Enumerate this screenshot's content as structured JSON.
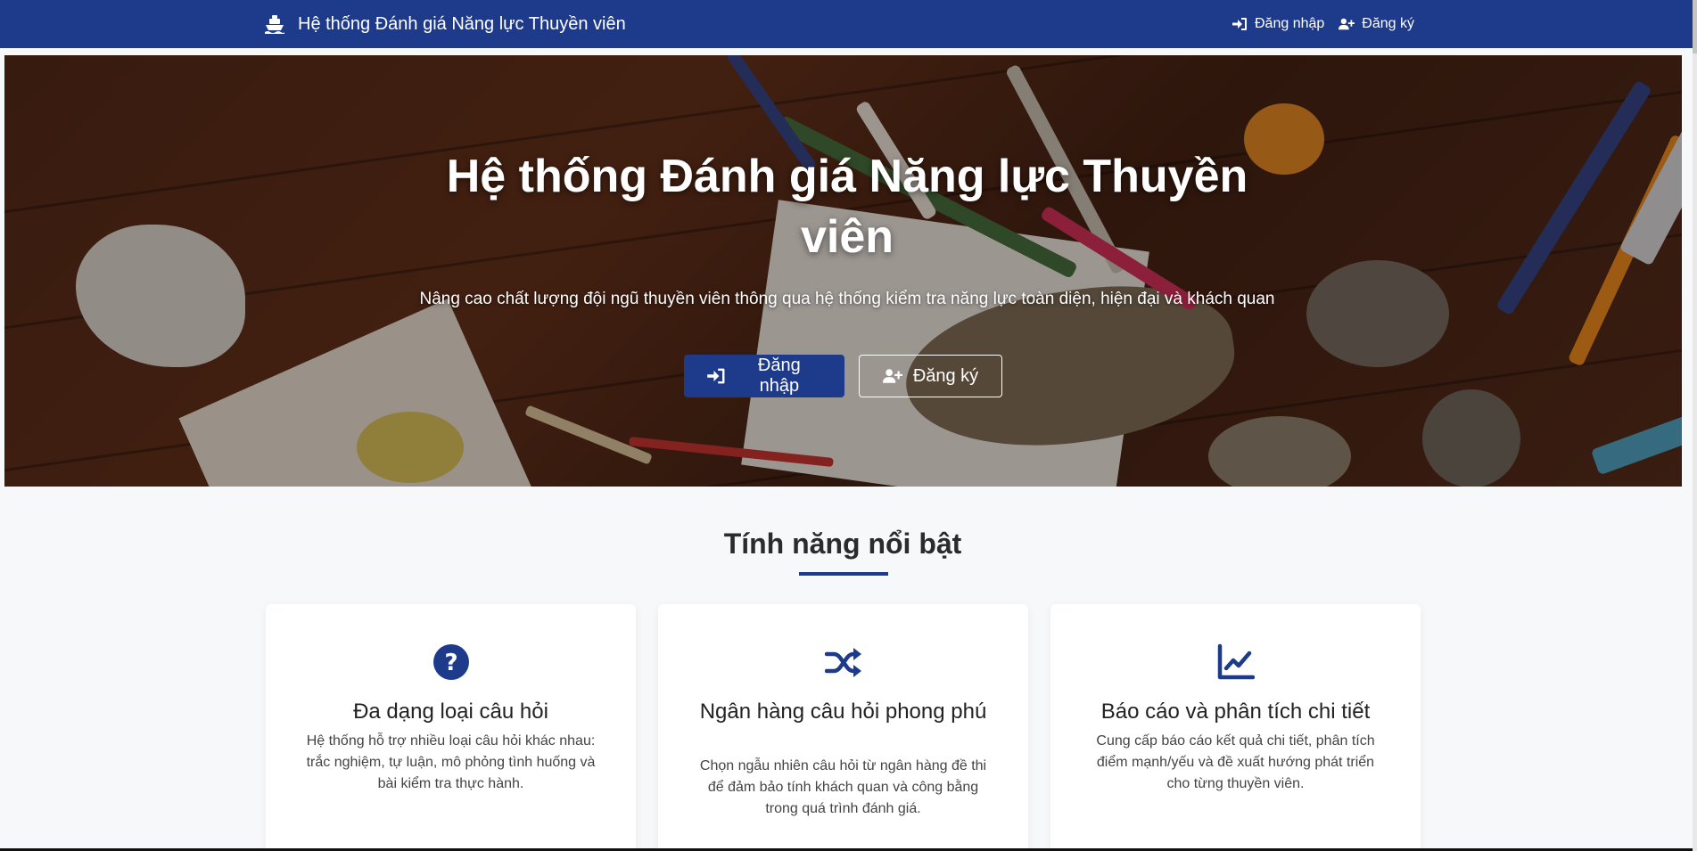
{
  "navbar": {
    "brand": "Hệ thống Đánh giá Năng lực Thuyền viên",
    "brand_icon": "ship-icon",
    "login": "Đăng nhập",
    "register": "Đăng ký",
    "login_icon": "sign-in-icon",
    "register_icon": "user-plus-icon",
    "color": "#1e3a8a"
  },
  "hero": {
    "title": "Hệ thống Đánh giá Năng lực Thuyền viên",
    "subtitle": "Nâng cao chất lượng đội ngũ thuyền viên thông qua hệ thống kiểm tra năng lực toàn diện, hiện đại và khách quan",
    "login_button": "Đăng nhập",
    "register_button": "Đăng ký"
  },
  "features": {
    "title": "Tính năng nổi bật",
    "accent": "#1e3a8a",
    "cards": [
      {
        "icon": "question-circle-icon",
        "title": "Đa dạng loại câu hỏi",
        "description": "Hệ thống hỗ trợ nhiều loại câu hỏi khác nhau: trắc nghiệm, tự luận, mô phỏng tình huống và bài kiểm tra thực hành."
      },
      {
        "icon": "shuffle-icon",
        "title": "Ngân hàng câu hỏi phong phú",
        "description": "Chọn ngẫu nhiên câu hỏi từ ngân hàng đề thi để đảm bảo tính khách quan và công bằng trong quá trình đánh giá."
      },
      {
        "icon": "chart-line-icon",
        "title": "Báo cáo và phân tích chi tiết",
        "description": "Cung cấp báo cáo kết quả chi tiết, phân tích điểm mạnh/yếu và đề xuất hướng phát triển cho từng thuyền viên."
      }
    ]
  }
}
